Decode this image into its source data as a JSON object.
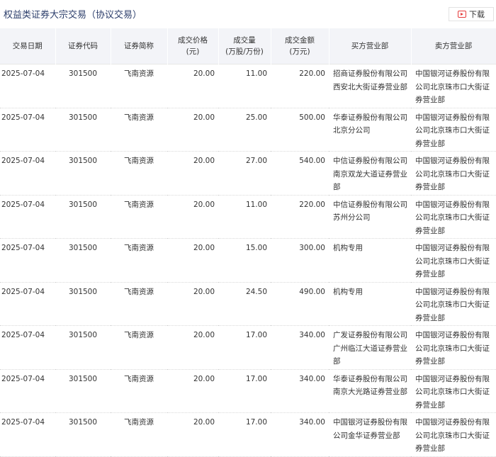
{
  "title": "权益类证券大宗交易（协议交易）",
  "download": {
    "label": "下载",
    "icon": "download-icon"
  },
  "accent_color": "#e63b3b",
  "columns": [
    "交易日期",
    "证券代码",
    "证券简称",
    "成交价格\n(元)",
    "成交量\n(万股/万份)",
    "成交金额\n(万元)",
    "买方营业部",
    "卖方营业部"
  ],
  "rows": [
    {
      "date": "2025-07-04",
      "code": "301500",
      "name": "飞南资源",
      "price": "20.00",
      "volume": "11.00",
      "amount": "220.00",
      "buyer": "招商证券股份有限公司西安北大街证券营业部",
      "seller": "中国银河证券股份有限公司北京珠市口大街证券营业部"
    },
    {
      "date": "2025-07-04",
      "code": "301500",
      "name": "飞南资源",
      "price": "20.00",
      "volume": "25.00",
      "amount": "500.00",
      "buyer": "华泰证券股份有限公司北京分公司",
      "seller": "中国银河证券股份有限公司北京珠市口大街证券营业部"
    },
    {
      "date": "2025-07-04",
      "code": "301500",
      "name": "飞南资源",
      "price": "20.00",
      "volume": "27.00",
      "amount": "540.00",
      "buyer": "中信证券股份有限公司南京双龙大道证券营业部",
      "seller": "中国银河证券股份有限公司北京珠市口大街证券营业部"
    },
    {
      "date": "2025-07-04",
      "code": "301500",
      "name": "飞南资源",
      "price": "20.00",
      "volume": "11.00",
      "amount": "220.00",
      "buyer": "中信证券股份有限公司苏州分公司",
      "seller": "中国银河证券股份有限公司北京珠市口大街证券营业部"
    },
    {
      "date": "2025-07-04",
      "code": "301500",
      "name": "飞南资源",
      "price": "20.00",
      "volume": "15.00",
      "amount": "300.00",
      "buyer": "机构专用",
      "seller": "中国银河证券股份有限公司北京珠市口大街证券营业部"
    },
    {
      "date": "2025-07-04",
      "code": "301500",
      "name": "飞南资源",
      "price": "20.00",
      "volume": "24.50",
      "amount": "490.00",
      "buyer": "机构专用",
      "seller": "中国银河证券股份有限公司北京珠市口大街证券营业部"
    },
    {
      "date": "2025-07-04",
      "code": "301500",
      "name": "飞南资源",
      "price": "20.00",
      "volume": "17.00",
      "amount": "340.00",
      "buyer": "广发证券股份有限公司广州临江大道证券营业部",
      "seller": "中国银河证券股份有限公司北京珠市口大街证券营业部"
    },
    {
      "date": "2025-07-04",
      "code": "301500",
      "name": "飞南资源",
      "price": "20.00",
      "volume": "17.00",
      "amount": "340.00",
      "buyer": "华泰证券股份有限公司南京大光路证券营业部",
      "seller": "中国银河证券股份有限公司北京珠市口大街证券营业部"
    },
    {
      "date": "2025-07-04",
      "code": "301500",
      "name": "飞南资源",
      "price": "20.00",
      "volume": "17.00",
      "amount": "340.00",
      "buyer": "中国银河证券股份有限公司金华证券营业部",
      "seller": "中国银河证券股份有限公司北京珠市口大街证券营业部"
    }
  ]
}
